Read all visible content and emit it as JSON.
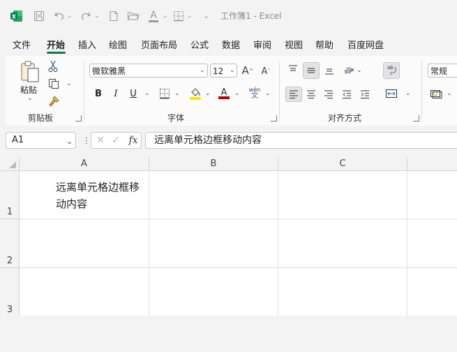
{
  "window": {
    "title": "工作簿1  -  Excel"
  },
  "quick_access": {
    "icons": [
      "excel-logo-icon",
      "save-icon",
      "undo-icon",
      "redo-icon",
      "new-file-icon",
      "open-folder-icon",
      "font-color-icon",
      "borders-icon",
      "customize-icon"
    ]
  },
  "menu": {
    "items": [
      "文件",
      "开始",
      "插入",
      "绘图",
      "页面布局",
      "公式",
      "数据",
      "审阅",
      "视图",
      "帮助",
      "百度网盘"
    ],
    "active": "开始"
  },
  "ribbon": {
    "clipboard": {
      "paste_label": "粘贴",
      "group_label": "剪贴板"
    },
    "font": {
      "font_name": "微软雅黑",
      "font_size": "12",
      "bold": "B",
      "italic": "I",
      "underline": "U",
      "phonetic_top": "wén",
      "phonetic_bottom": "文",
      "grow": "A",
      "shrink": "A",
      "group_label": "字体"
    },
    "alignment": {
      "group_label": "对齐方式",
      "wrap_icon_text": "ab c"
    },
    "number": {
      "format": "常规"
    }
  },
  "formula_bar": {
    "name_box": "A1",
    "fx_label": "fx",
    "formula": "远离单元格边框移动内容"
  },
  "sheet": {
    "columns": [
      "A",
      "B",
      "C"
    ],
    "rows": [
      "1",
      "2",
      "3"
    ],
    "cells": {
      "A1": "远离单元格边框移动内容"
    }
  },
  "colors": {
    "accent": "#107c41",
    "excel_green": "#1d6f42"
  }
}
